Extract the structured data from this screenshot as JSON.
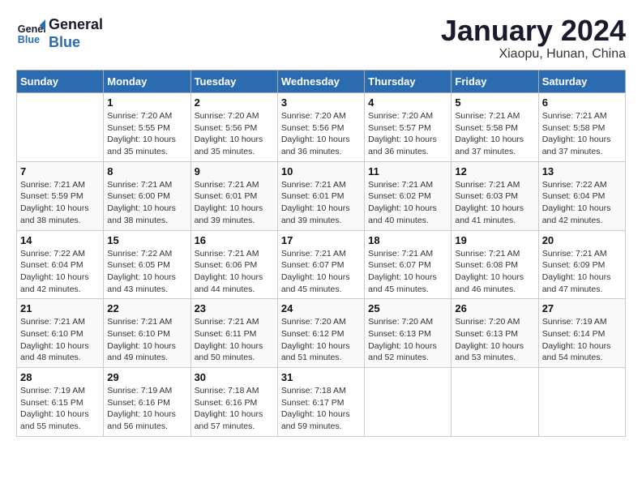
{
  "header": {
    "logo_line1": "General",
    "logo_line2": "Blue",
    "month_title": "January 2024",
    "location": "Xiaopu, Hunan, China"
  },
  "weekdays": [
    "Sunday",
    "Monday",
    "Tuesday",
    "Wednesday",
    "Thursday",
    "Friday",
    "Saturday"
  ],
  "weeks": [
    [
      {
        "day": "",
        "sunrise": "",
        "sunset": "",
        "daylight": ""
      },
      {
        "day": "1",
        "sunrise": "7:20 AM",
        "sunset": "5:55 PM",
        "daylight": "10 hours and 35 minutes."
      },
      {
        "day": "2",
        "sunrise": "7:20 AM",
        "sunset": "5:56 PM",
        "daylight": "10 hours and 35 minutes."
      },
      {
        "day": "3",
        "sunrise": "7:20 AM",
        "sunset": "5:56 PM",
        "daylight": "10 hours and 36 minutes."
      },
      {
        "day": "4",
        "sunrise": "7:20 AM",
        "sunset": "5:57 PM",
        "daylight": "10 hours and 36 minutes."
      },
      {
        "day": "5",
        "sunrise": "7:21 AM",
        "sunset": "5:58 PM",
        "daylight": "10 hours and 37 minutes."
      },
      {
        "day": "6",
        "sunrise": "7:21 AM",
        "sunset": "5:58 PM",
        "daylight": "10 hours and 37 minutes."
      }
    ],
    [
      {
        "day": "7",
        "sunrise": "7:21 AM",
        "sunset": "5:59 PM",
        "daylight": "10 hours and 38 minutes."
      },
      {
        "day": "8",
        "sunrise": "7:21 AM",
        "sunset": "6:00 PM",
        "daylight": "10 hours and 38 minutes."
      },
      {
        "day": "9",
        "sunrise": "7:21 AM",
        "sunset": "6:01 PM",
        "daylight": "10 hours and 39 minutes."
      },
      {
        "day": "10",
        "sunrise": "7:21 AM",
        "sunset": "6:01 PM",
        "daylight": "10 hours and 39 minutes."
      },
      {
        "day": "11",
        "sunrise": "7:21 AM",
        "sunset": "6:02 PM",
        "daylight": "10 hours and 40 minutes."
      },
      {
        "day": "12",
        "sunrise": "7:21 AM",
        "sunset": "6:03 PM",
        "daylight": "10 hours and 41 minutes."
      },
      {
        "day": "13",
        "sunrise": "7:22 AM",
        "sunset": "6:04 PM",
        "daylight": "10 hours and 42 minutes."
      }
    ],
    [
      {
        "day": "14",
        "sunrise": "7:22 AM",
        "sunset": "6:04 PM",
        "daylight": "10 hours and 42 minutes."
      },
      {
        "day": "15",
        "sunrise": "7:22 AM",
        "sunset": "6:05 PM",
        "daylight": "10 hours and 43 minutes."
      },
      {
        "day": "16",
        "sunrise": "7:21 AM",
        "sunset": "6:06 PM",
        "daylight": "10 hours and 44 minutes."
      },
      {
        "day": "17",
        "sunrise": "7:21 AM",
        "sunset": "6:07 PM",
        "daylight": "10 hours and 45 minutes."
      },
      {
        "day": "18",
        "sunrise": "7:21 AM",
        "sunset": "6:07 PM",
        "daylight": "10 hours and 45 minutes."
      },
      {
        "day": "19",
        "sunrise": "7:21 AM",
        "sunset": "6:08 PM",
        "daylight": "10 hours and 46 minutes."
      },
      {
        "day": "20",
        "sunrise": "7:21 AM",
        "sunset": "6:09 PM",
        "daylight": "10 hours and 47 minutes."
      }
    ],
    [
      {
        "day": "21",
        "sunrise": "7:21 AM",
        "sunset": "6:10 PM",
        "daylight": "10 hours and 48 minutes."
      },
      {
        "day": "22",
        "sunrise": "7:21 AM",
        "sunset": "6:10 PM",
        "daylight": "10 hours and 49 minutes."
      },
      {
        "day": "23",
        "sunrise": "7:21 AM",
        "sunset": "6:11 PM",
        "daylight": "10 hours and 50 minutes."
      },
      {
        "day": "24",
        "sunrise": "7:20 AM",
        "sunset": "6:12 PM",
        "daylight": "10 hours and 51 minutes."
      },
      {
        "day": "25",
        "sunrise": "7:20 AM",
        "sunset": "6:13 PM",
        "daylight": "10 hours and 52 minutes."
      },
      {
        "day": "26",
        "sunrise": "7:20 AM",
        "sunset": "6:13 PM",
        "daylight": "10 hours and 53 minutes."
      },
      {
        "day": "27",
        "sunrise": "7:19 AM",
        "sunset": "6:14 PM",
        "daylight": "10 hours and 54 minutes."
      }
    ],
    [
      {
        "day": "28",
        "sunrise": "7:19 AM",
        "sunset": "6:15 PM",
        "daylight": "10 hours and 55 minutes."
      },
      {
        "day": "29",
        "sunrise": "7:19 AM",
        "sunset": "6:16 PM",
        "daylight": "10 hours and 56 minutes."
      },
      {
        "day": "30",
        "sunrise": "7:18 AM",
        "sunset": "6:16 PM",
        "daylight": "10 hours and 57 minutes."
      },
      {
        "day": "31",
        "sunrise": "7:18 AM",
        "sunset": "6:17 PM",
        "daylight": "10 hours and 59 minutes."
      },
      {
        "day": "",
        "sunrise": "",
        "sunset": "",
        "daylight": ""
      },
      {
        "day": "",
        "sunrise": "",
        "sunset": "",
        "daylight": ""
      },
      {
        "day": "",
        "sunrise": "",
        "sunset": "",
        "daylight": ""
      }
    ]
  ]
}
